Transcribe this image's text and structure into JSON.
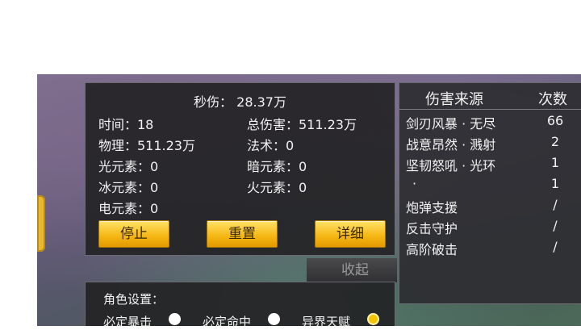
{
  "dps": {
    "label": "秒伤：",
    "value": "28.37万"
  },
  "stats": {
    "time": "时间：18",
    "total_damage": "总伤害：511.23万",
    "physical": "物理：511.23万",
    "magic": "法术：0",
    "light": "光元素：0",
    "dark": "暗元素：0",
    "ice": "冰元素：0",
    "fire": "火元素：0",
    "electric": "电元素：0"
  },
  "buttons": {
    "stop": "停止",
    "reset": "重置",
    "detail": "详细"
  },
  "collapse": "收起",
  "role_settings": {
    "title": "角色设置：",
    "options": [
      {
        "label": "必定暴击",
        "selected": false
      },
      {
        "label": "必定命中",
        "selected": false
      },
      {
        "label": "异界天赋",
        "selected": true
      }
    ]
  },
  "damage_sources": {
    "header_source": "伤害来源",
    "header_count": "次数",
    "rows": [
      {
        "name": "剑刃风暴 · 无尽",
        "count": "66"
      },
      {
        "name": "战意昂然 · 溅射",
        "count": "2"
      },
      {
        "name": "坚韧怒吼 · 光环",
        "count": "1"
      },
      {
        "name": "·",
        "count": "1"
      },
      {
        "name": "炮弹支援",
        "count": "/"
      },
      {
        "name": "反击守护",
        "count": "/"
      },
      {
        "name": "高阶破击",
        "count": "/"
      }
    ]
  },
  "colors": {
    "button_gold": "#f5b512",
    "radio_selected": "#f5c400",
    "panel_bg": "#232326"
  }
}
